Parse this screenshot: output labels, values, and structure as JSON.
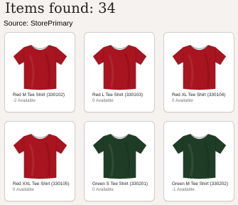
{
  "header": {
    "items_found_label": "Items found:",
    "items_found_count": "34",
    "source_label": "Source:",
    "source_value": "StorePrimary"
  },
  "products": [
    {
      "name": "Red M Tee Shirt (330102)",
      "availability": "-2 Available",
      "color": "#a8141f",
      "icon": "t-shirt-icon"
    },
    {
      "name": "Red L Tee Shirt (330103)",
      "availability": "0 Available",
      "color": "#a8141f",
      "icon": "t-shirt-icon"
    },
    {
      "name": "Red XL Tee Shirt (330104)",
      "availability": "0 Available",
      "color": "#a8141f",
      "icon": "t-shirt-icon"
    },
    {
      "name": "Red XXL Tee Shirt (330105)",
      "availability": "0 Available",
      "color": "#a8141f",
      "icon": "t-shirt-icon"
    },
    {
      "name": "Green S Tee Shirt (330201)",
      "availability": "0 Available",
      "color": "#1f3d26",
      "icon": "t-shirt-icon"
    },
    {
      "name": "Green M Tee Shirt (330202)",
      "availability": "-1 Available",
      "color": "#1f3d26",
      "icon": "t-shirt-icon"
    }
  ]
}
